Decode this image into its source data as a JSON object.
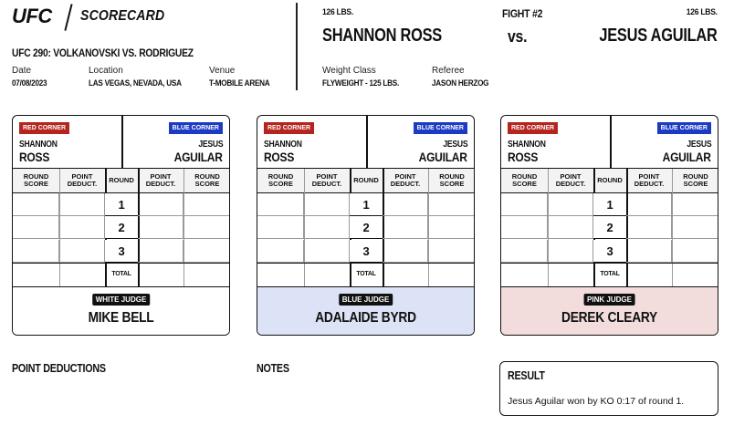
{
  "header": {
    "brand": "UFC",
    "doc_title": "SCORECARD",
    "event_title": "UFC 290: VOLKANOVSKI VS. RODRIGUEZ",
    "date_label": "Date",
    "date": "07/08/2023",
    "location_label": "Location",
    "location": "LAS VEGAS, NEVADA, USA",
    "venue_label": "Venue",
    "venue": "T-MOBILE ARENA",
    "weight_class_label": "Weight Class",
    "weight_class": "FLYWEIGHT - 125 LBS.",
    "referee_label": "Referee",
    "referee": "JASON HERZOG"
  },
  "fight": {
    "number": "FIGHT #2",
    "vs": "vs.",
    "red_fighter": "SHANNON ROSS",
    "red_weight": "126 LBS.",
    "blue_fighter": "JESUS AGUILAR",
    "blue_weight": "126 LBS."
  },
  "card_labels": {
    "red_corner": "RED CORNER",
    "blue_corner": "BLUE CORNER",
    "red_first": "SHANNON",
    "red_last": "ROSS",
    "blue_first": "JESUS",
    "blue_last": "AGUILAR",
    "round_score": "ROUND SCORE",
    "point_deduct": "POINT DEDUCT.",
    "round": "ROUND",
    "total": "TOTAL",
    "rounds": [
      "1",
      "2",
      "3"
    ]
  },
  "judges": [
    {
      "badge": "WHITE JUDGE",
      "name": "MIKE BELL",
      "bg": "#ffffff"
    },
    {
      "badge": "BLUE JUDGE",
      "name": "ADALAIDE BYRD",
      "bg": "#dde3f6"
    },
    {
      "badge": "PINK JUDGE",
      "name": "DEREK CLEARY",
      "bg": "#f3dcdc"
    }
  ],
  "sections": {
    "point_deductions": "POINT DEDUCTIONS",
    "notes": "NOTES",
    "result_title": "RESULT",
    "result_text": "Jesus Aguilar won by KO 0:17 of round 1."
  },
  "colors": {
    "red_corner": "#b5251f",
    "blue_corner": "#1d3bc2"
  }
}
